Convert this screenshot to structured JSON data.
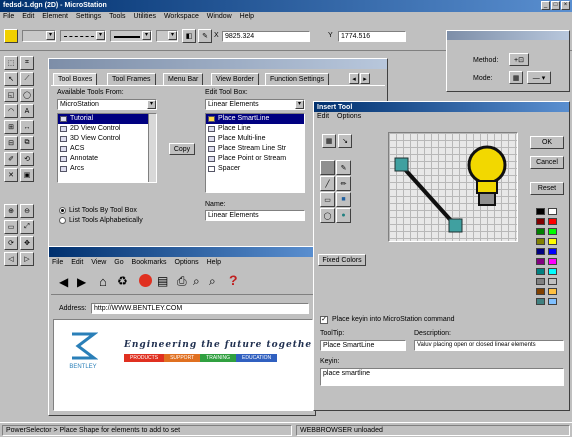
{
  "app": {
    "title": "fedsd-1.dgn (2D) - MicroStation",
    "menu": [
      "File",
      "Edit",
      "Element",
      "Settings",
      "Tools",
      "Utilities",
      "Workspace",
      "Window",
      "Help"
    ],
    "coord_x_label": "X",
    "coord_x_value": "9825.324",
    "coord_y_label": "Y",
    "coord_y_value": "1774.516"
  },
  "mini_dialog": {
    "method_label": "Method:",
    "mode_label": "Mode:"
  },
  "customize": {
    "tabs": [
      "Tool Boxes",
      "Tool Frames",
      "Menu Bar",
      "View Border",
      "Function Settings"
    ],
    "available_label": "Available Tools From:",
    "available_value": "MicroStation",
    "edit_label": "Edit Tool Box:",
    "edit_value": "Linear Elements",
    "left_list": [
      "Tutorial",
      "2D View Control",
      "3D View Control",
      "ACS",
      "Annotate",
      "Arcs"
    ],
    "right_list": [
      "Place SmartLine",
      "Place Line",
      "Place Multi-line",
      "Place Stream Line Str",
      "Place Point or Stream",
      "Spacer"
    ],
    "copy_label": "Copy",
    "radio1": "List Tools By Tool Box",
    "radio2": "List Tools Alphabetically",
    "name_label": "Name:",
    "name_value": "Linear Elements"
  },
  "insert_tool": {
    "title": "Insert Tool",
    "menu": [
      "Edit",
      "Options"
    ],
    "ok": "OK",
    "cancel": "Cancel",
    "reset": "Reset",
    "fixed_colors": "Fixed Colors",
    "check_label": "Place keyin into MicroStation command",
    "tooltip_label": "ToolTip:",
    "tooltip_value": "Place SmartLine",
    "description_label": "Description:",
    "description_value": "Valuv placing open or closed linear elements",
    "keyin_label": "Keyin:",
    "keyin_value": "place smartline",
    "colors": [
      "#000000",
      "#ffffff",
      "#800000",
      "#ff0000",
      "#008000",
      "#00ff00",
      "#808000",
      "#ffff00",
      "#000080",
      "#0000ff",
      "#800080",
      "#ff00ff",
      "#008080",
      "#00ffff",
      "#808080",
      "#c0c0c0",
      "#804000",
      "#ffc040",
      "#408080",
      "#80c0ff"
    ]
  },
  "browser": {
    "menu": [
      "File",
      "Edit",
      "View",
      "Go",
      "Bookmarks",
      "Options",
      "Help"
    ],
    "address_label": "Address:",
    "address_value": "http://WWW.BENTLEY.COM",
    "logo_text": "BENTLEY",
    "tagline": "Engineering the future togethe",
    "nav": [
      "PRODUCTS",
      "SUPPORT",
      "TRAINING",
      "EDUCATION"
    ]
  },
  "status": {
    "left": "PowerSelector > Place Shape for elements to add to set",
    "right": "WEBBROWSER unloaded"
  }
}
